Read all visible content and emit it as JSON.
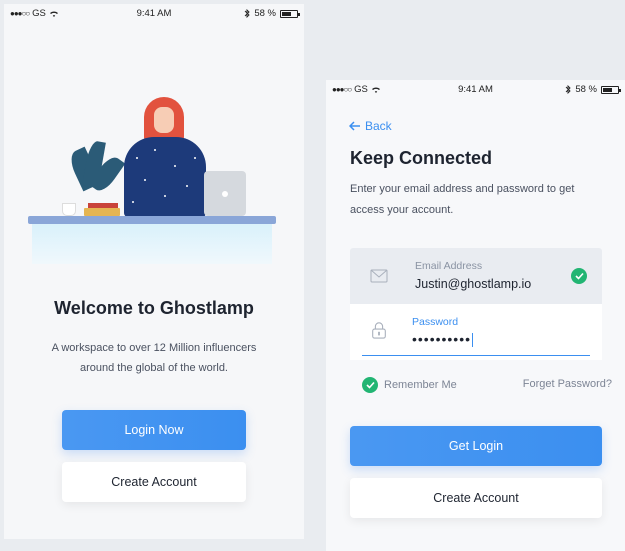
{
  "status_bar": {
    "signal_dots": "●●●○○",
    "carrier": "GS",
    "time": "9:41 AM",
    "battery": "58 %"
  },
  "welcome": {
    "title": "Welcome to Ghostlamp",
    "subtitle": "A workspace to over 12 Million influencers around the global of the world.",
    "login_button": "Login Now",
    "create_button": "Create Account"
  },
  "login": {
    "back": "Back",
    "title": "Keep Connected",
    "subtitle": "Enter your email address and password to get access your account.",
    "email_label": "Email Address",
    "email_value": "Justin@ghostlamp.io",
    "password_label": "Password",
    "password_value": "••••••••••",
    "remember": "Remember Me",
    "forgot": "Forget Password?",
    "login_button": "Get Login",
    "create_button": "Create Account"
  },
  "colors": {
    "accent": "#3b8ff0",
    "success": "#22b573",
    "text": "#1e2430"
  },
  "icons": [
    "wifi-icon",
    "bluetooth-icon",
    "battery-icon",
    "back-arrow-icon",
    "mail-icon",
    "lock-icon",
    "check-icon"
  ]
}
